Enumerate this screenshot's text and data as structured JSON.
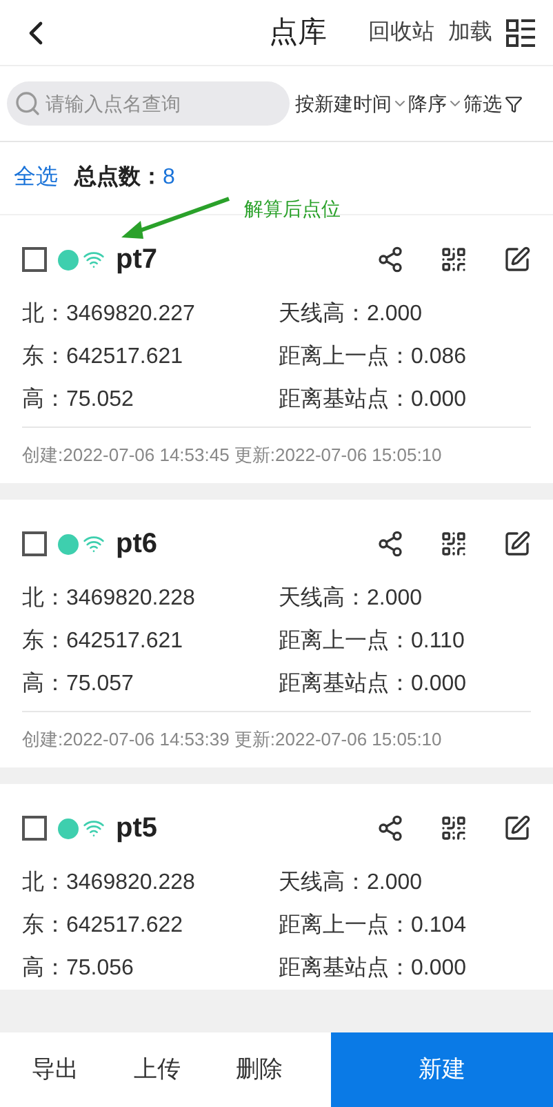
{
  "header": {
    "title": "点库",
    "actions": [
      "回收站",
      "加载"
    ]
  },
  "search": {
    "placeholder": "请输入点名查询"
  },
  "sort": {
    "field": "按新建时间",
    "order": "降序",
    "filter": "筛选"
  },
  "summary": {
    "select_all": "全选",
    "total_label": "总点数：",
    "total": "8"
  },
  "annotation": {
    "text": "解算后点位"
  },
  "cards": [
    {
      "name": "pt7",
      "checked": false,
      "color": "#3ecfae",
      "rows": [
        {
          "label": "北：",
          "value": "3469820.227",
          "label2": "天线高：",
          "value2": "2.000"
        },
        {
          "label": "东：",
          "value": "642517.621",
          "label2": "距离上一点：",
          "value2": "0.086"
        },
        {
          "label": "高：",
          "value": "75.052",
          "label2": "距离基站点：",
          "value2": "0.000"
        }
      ],
      "footer": "创建:2022-07-06 14:53:45 更新:2022-07-06 15:05:10"
    },
    {
      "name": "pt6",
      "checked": false,
      "color": "#3ecfae",
      "rows": [
        {
          "label": "北：",
          "value": "3469820.228",
          "label2": "天线高：",
          "value2": "2.000"
        },
        {
          "label": "东：",
          "value": "642517.621",
          "label2": "距离上一点：",
          "value2": "0.110"
        },
        {
          "label": "高：",
          "value": "75.057",
          "label2": "距离基站点：",
          "value2": "0.000"
        }
      ],
      "footer": "创建:2022-07-06 14:53:39 更新:2022-07-06 15:05:10"
    },
    {
      "name": "pt5",
      "checked": false,
      "color": "#3ecfae",
      "rows": [
        {
          "label": "北：",
          "value": "3469820.228",
          "label2": "天线高：",
          "value2": "2.000"
        },
        {
          "label": "东：",
          "value": "642517.622",
          "label2": "距离上一点：",
          "value2": "0.104"
        },
        {
          "label": "高：",
          "value": "75.056",
          "label2": "距离基站点：",
          "value2": "0.000"
        }
      ]
    }
  ],
  "bottom_bar": [
    {
      "label": "导出",
      "kind": "plain"
    },
    {
      "label": "上传",
      "kind": "plain"
    },
    {
      "label": "删除",
      "kind": "plain"
    },
    {
      "label": "新建",
      "kind": "primary"
    }
  ]
}
